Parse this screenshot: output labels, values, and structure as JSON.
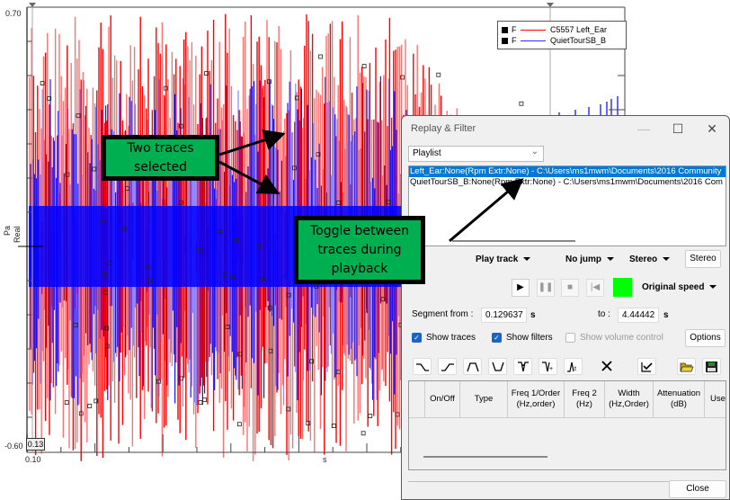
{
  "plot": {
    "y_max_label": "0.70",
    "y_min_label": "-0.60",
    "x_min_label": "0.10",
    "x_unit_label": "s",
    "y_unit_label": "Pa",
    "y_type_label": "Real",
    "cursor_value": "0.13",
    "legend": [
      {
        "flag": "F",
        "name": "C5557 Left_Ear",
        "color": "#ff0000"
      },
      {
        "flag": "F",
        "name": "QuietTourSB_B",
        "color": "#3333ff"
      }
    ],
    "colors": {
      "red_trace": "#ff0000",
      "blue_trace": "#0000ff",
      "overlap": "#8b008b"
    }
  },
  "callouts": {
    "two_traces": "Two traces selected",
    "toggle": "Toggle between traces during playback"
  },
  "dialog": {
    "title": "Replay & Filter",
    "minimize": "—",
    "maximize": "☐",
    "close": "✕",
    "playlist_label": "Playlist",
    "tracks": [
      {
        "label": "Left_Ear:None(Rpm Extr:None) - C:\\Users\\ms1mwm\\Documents\\2016 Community",
        "selected": true
      },
      {
        "label": "QuietTourSB_B:None(Rpm Extr:None) - C:\\Users\\ms1mwm\\Documents\\2016 Com",
        "selected": false
      }
    ],
    "play_mode": "Play track",
    "jump_mode": "No jump",
    "channel_mode": "Stereo",
    "stereo_button": "Stereo",
    "speed": "Original speed",
    "segment_from_label": "Segment from :",
    "segment_from_value": "0.129637",
    "segment_unit": "s",
    "segment_to_label": "to :",
    "segment_to_value": "4.44442",
    "show_traces": "Show traces",
    "show_filters": "Show filters",
    "show_volume": "Show volume control",
    "options_button": "Options",
    "indicator_color": "#00ff00",
    "grid_headers": [
      "",
      "On/Off",
      "Type",
      "Freq 1/Order\n(Hz,order)",
      "Freq 2\n(Hz)",
      "Width\n(Hz,Order)",
      "Attenuation\n(dB)",
      "Use"
    ],
    "close_button": "Close"
  }
}
